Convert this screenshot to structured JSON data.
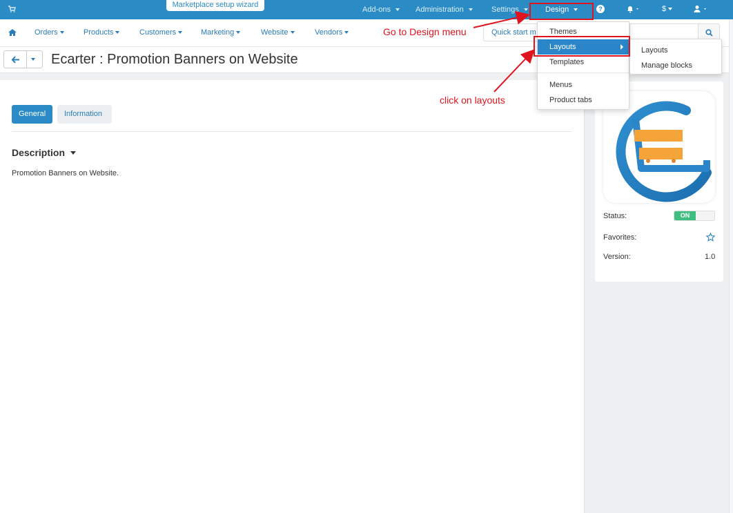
{
  "topbar": {
    "wizard_label": "Marketplace setup wizard",
    "items": [
      {
        "label": "Add-ons"
      },
      {
        "label": "Administration"
      },
      {
        "label": "Settings"
      },
      {
        "label": "Design"
      }
    ],
    "currency_label": "$",
    "icons": [
      "cart-icon",
      "help-icon",
      "bell-icon",
      "user-icon"
    ],
    "accent_color": "#2a8bc5"
  },
  "mainnav": {
    "items": [
      {
        "label": "Orders"
      },
      {
        "label": "Products"
      },
      {
        "label": "Customers"
      },
      {
        "label": "Marketing"
      },
      {
        "label": "Website"
      },
      {
        "label": "Vendors"
      }
    ],
    "quickstart_label": "Quick start m",
    "search_placeholder": ""
  },
  "page": {
    "title": "Ecarter : Promotion Banners on Website"
  },
  "tabs": [
    {
      "label": "General"
    },
    {
      "label": "Information"
    }
  ],
  "description": {
    "title": "Description",
    "text": "Promotion Banners on Website."
  },
  "sidebar": {
    "status_label": "Status:",
    "status_value": "ON",
    "favorites_label": "Favorites:",
    "version_label": "Version:",
    "version_value": "1.0"
  },
  "design_menu": {
    "items": [
      {
        "label": "Themes"
      },
      {
        "label": "Layouts"
      },
      {
        "label": "Templates"
      },
      {
        "label": "Menus"
      },
      {
        "label": "Product tabs"
      }
    ],
    "submenu": [
      {
        "label": "Layouts"
      },
      {
        "label": "Manage blocks"
      }
    ]
  },
  "annotations": {
    "go_design": "Go to Design menu",
    "click_layouts": "click on layouts",
    "color": "#e0141e"
  }
}
